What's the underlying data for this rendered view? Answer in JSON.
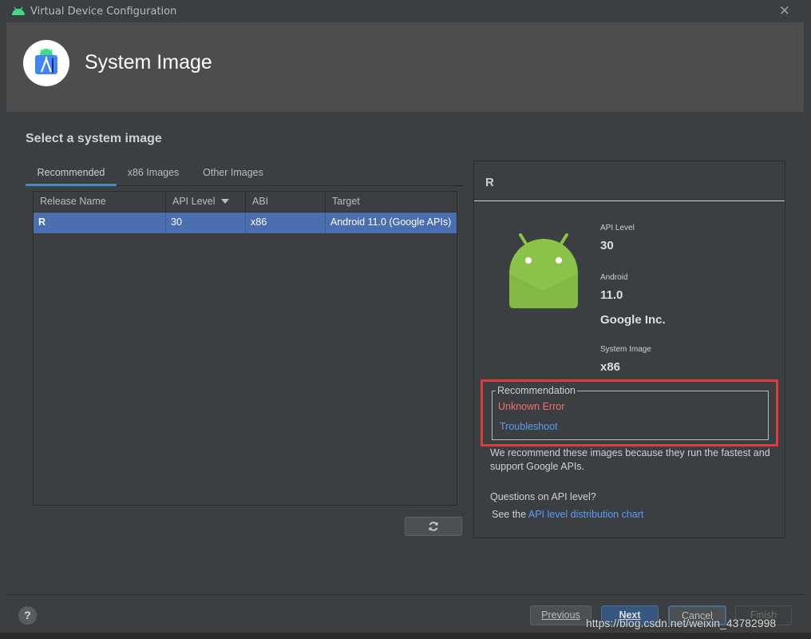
{
  "window": {
    "title": "Virtual Device Configuration"
  },
  "header": {
    "title": "System Image"
  },
  "main": {
    "section_title": "Select a system image",
    "tabs": [
      {
        "label": "Recommended",
        "active": true
      },
      {
        "label": "x86 Images",
        "active": false
      },
      {
        "label": "Other Images",
        "active": false
      }
    ],
    "table": {
      "columns": [
        "Release Name",
        "API Level",
        "ABI",
        "Target"
      ],
      "sort_column": "API Level",
      "rows": [
        {
          "release_name": "R",
          "api_level": "30",
          "abi": "x86",
          "target": "Android 11.0 (Google APIs)",
          "selected": true
        }
      ]
    }
  },
  "details": {
    "release_name": "R",
    "api_level_label": "API Level",
    "api_level": "30",
    "android_label": "Android",
    "android_version": "11.0",
    "vendor": "Google Inc.",
    "system_image_label": "System Image",
    "system_image": "x86",
    "recommendation_label": "Recommendation",
    "recommendation_error": "Unknown Error",
    "troubleshoot_link": "Troubleshoot",
    "description": "We recommend these images because they run the fastest and support Google APIs.",
    "questions_text": "Questions on API level?",
    "see_the_text": "See the ",
    "chart_link": "API level distribution chart"
  },
  "footer": {
    "help_label": "?",
    "previous_label": "Previous",
    "next_label": "Next",
    "cancel_label": "Cancel",
    "finish_label": "Finish"
  },
  "watermark": "https://blog.csdn.net/weixin_43782998",
  "colors": {
    "selection": "#4b6eaf",
    "error": "#ff6b68",
    "link": "#589df6",
    "highlight_outline": "#e03a3a",
    "android_green": "#8bc34a"
  },
  "icons": [
    "android-icon",
    "android-studio-logo-icon",
    "sort-desc-icon",
    "refresh-icon",
    "close-icon",
    "help-icon"
  ]
}
